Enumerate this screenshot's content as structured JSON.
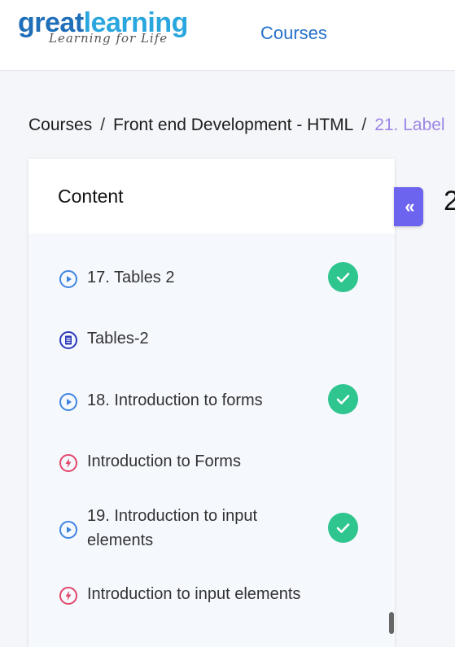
{
  "brand": {
    "logo_part1": "great",
    "logo_part2": "learning",
    "tagline": "Learning for Life",
    "colors": {
      "primary": "#1f6fb8",
      "secondary": "#2aa6df"
    }
  },
  "nav": {
    "courses_label": "Courses"
  },
  "breadcrumb": {
    "items": [
      "Courses",
      "Front end Development - HTML",
      "21. Label"
    ],
    "separator": "/"
  },
  "content_panel": {
    "title": "Content",
    "items": [
      {
        "label": "17. Tables 2",
        "icon": "play-circle-icon",
        "completed": true
      },
      {
        "label": "Tables-2",
        "icon": "document-icon",
        "completed": false
      },
      {
        "label": "18. Introduction to forms",
        "icon": "play-circle-icon",
        "completed": true
      },
      {
        "label": "Introduction to Forms",
        "icon": "quiz-bolt-icon",
        "completed": false
      },
      {
        "label": "19. Introduction to input elements",
        "icon": "play-circle-icon",
        "completed": true
      },
      {
        "label": "Introduction to input elements",
        "icon": "quiz-bolt-icon",
        "completed": false
      }
    ]
  },
  "collapse_button": {
    "icon": "double-chevron-left-icon",
    "glyph": "«"
  },
  "main": {
    "lesson_title_partial": "2"
  },
  "colors": {
    "accent": "#6c63ee",
    "check": "#2ec58f",
    "video_icon": "#3f84e0",
    "doc_icon": "#2c3ab8",
    "quiz_icon": "#e2466a",
    "breadcrumb_current": "#9d86e6",
    "link": "#2671c9"
  }
}
